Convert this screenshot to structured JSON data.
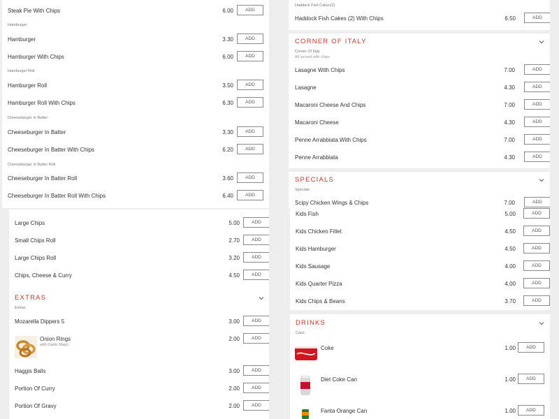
{
  "accent_color": "#c0392b",
  "add_label": "ADD",
  "left_top": {
    "items": [
      {
        "name": "Steak Pie With Chips",
        "price": "6.00"
      },
      {
        "category": "Hamburger"
      },
      {
        "name": "Hamburger",
        "price": "3.30"
      },
      {
        "name": "Hamburger With Chips",
        "price": "6.00"
      },
      {
        "category": "Hamburger Roll"
      },
      {
        "name": "Hamburger Roll",
        "price": "3.50"
      },
      {
        "name": "Hamburger Roll With Chips",
        "price": "6.30"
      },
      {
        "category": "Cheeseburger In Batter"
      },
      {
        "name": "Cheeseburger In Batter",
        "price": "3.30"
      },
      {
        "name": "Cheeseburger In Batter With Chips",
        "price": "6.20"
      },
      {
        "category": "Cheeseburger In Batter Roll"
      },
      {
        "name": "Cheeseburger In Batter Roll",
        "price": "3.60"
      },
      {
        "name": "Cheeseburger In Batter Roll With Chips",
        "price": "6.40"
      }
    ]
  },
  "left_bottom": {
    "chips_items": [
      {
        "name": "Large Chips",
        "price": "5.00"
      },
      {
        "name": "Small Chips Roll",
        "price": "2.70"
      },
      {
        "name": "Large Chips Roll",
        "price": "3.20"
      },
      {
        "name": "Chips, Cheese & Curry",
        "price": "4.50"
      }
    ],
    "extras": {
      "title": "Extras",
      "category": "Extras",
      "items": [
        {
          "name": "Mozarella Dippers 5",
          "price": "3.00"
        },
        {
          "name": "Onion Rings",
          "sub": "with Garlic Mayo",
          "price": "2.00",
          "icon": "onion-rings-image"
        },
        {
          "name": "Haggis Balls",
          "price": "3.00"
        },
        {
          "name": "Portion Of Curry",
          "price": "2.00"
        },
        {
          "name": "Portion Of Gravy",
          "price": "2.00"
        }
      ]
    }
  },
  "right_top": {
    "haddock": {
      "category": "Haddock Fish Cakes(2)",
      "item": {
        "name": "Haddock Fish Cakes (2) With Chips",
        "price": "6.50"
      }
    },
    "italy": {
      "title": "Corner Of Italy",
      "category": "Corner Of Italy",
      "category_sub": "All served with chips",
      "items": [
        {
          "name": "Lasagne With Chips",
          "price": "7.00"
        },
        {
          "name": "Lasagne",
          "price": "4.30"
        },
        {
          "name": "Macaroni Cheese And Chips",
          "price": "7.00"
        },
        {
          "name": "Macaroni Cheese",
          "price": "4.30"
        },
        {
          "name": "Penne Arrabbiata With Chips",
          "price": "7.00"
        },
        {
          "name": "Penne Arrabbiata",
          "price": "4.30"
        }
      ]
    },
    "specials": {
      "title": "Specials",
      "category": "Specials",
      "items": [
        {
          "name": "Scipy Chicken Wings & Chips",
          "price": "7.00"
        }
      ]
    }
  },
  "right_bottom": {
    "kids_items": [
      {
        "name": "Kids Fish",
        "price": "5.00"
      },
      {
        "name": "Kids Chicken Fillet",
        "price": "4.50"
      },
      {
        "name": "Kids Hamburger",
        "price": "4.50"
      },
      {
        "name": "Kids Sausage",
        "price": "4.00"
      },
      {
        "name": "Kids Quarter Pizza",
        "price": "4.00"
      },
      {
        "name": "Kids Chips & Beans",
        "price": "3.70"
      }
    ],
    "drinks": {
      "title": "Drinks",
      "category": "Cans",
      "items": [
        {
          "name": "Coke",
          "price": "1.00",
          "icon": "coke-can-image"
        },
        {
          "name": "Diet Coke Can",
          "price": "1.00",
          "icon": "diet-coke-can-image"
        },
        {
          "name": "Fanta Orange Can",
          "price": "1.00",
          "icon": "fanta-can-image"
        }
      ]
    }
  }
}
